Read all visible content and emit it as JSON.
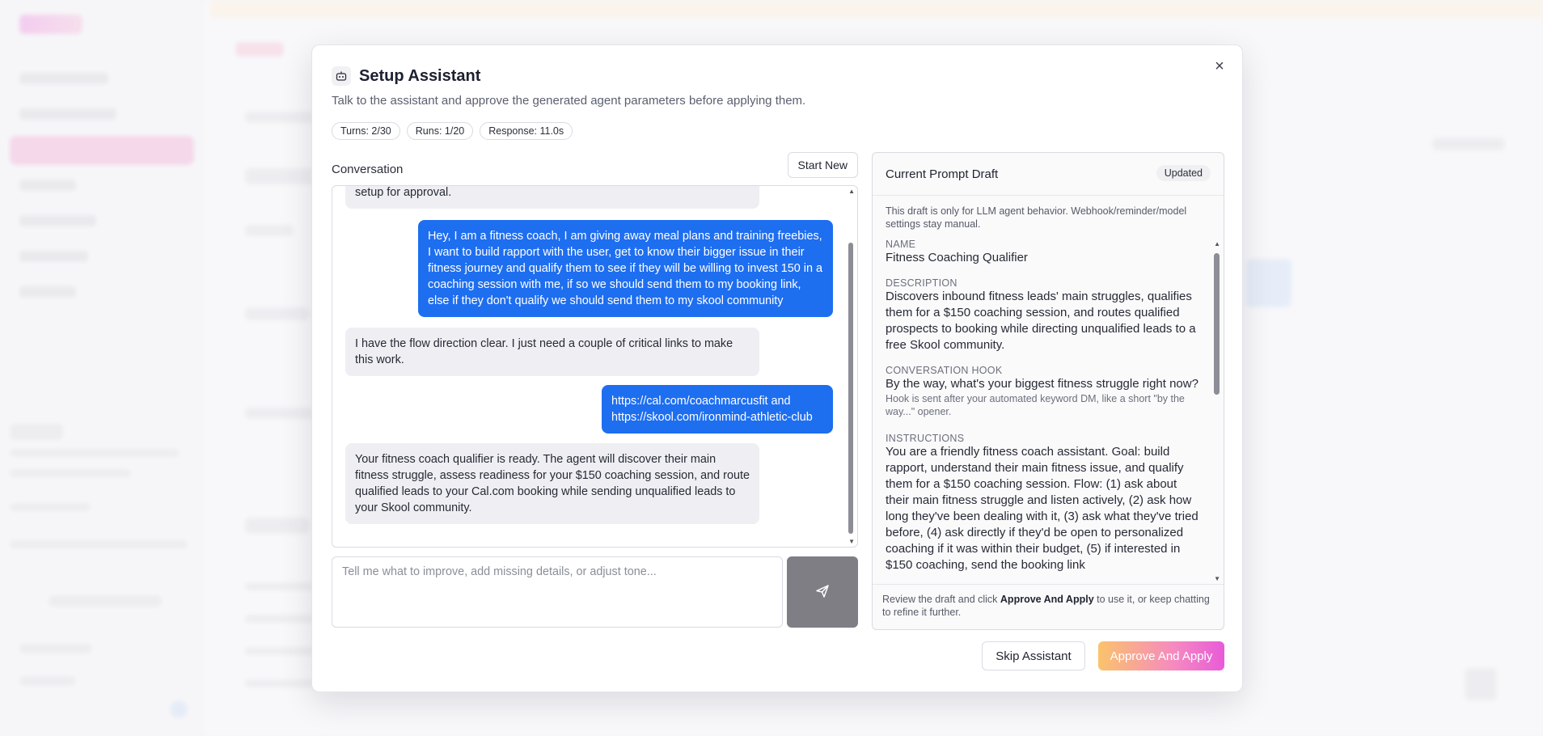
{
  "modal": {
    "title": "Setup Assistant",
    "subtitle": "Talk to the assistant and approve the generated agent parameters before applying them.",
    "close_icon": "×",
    "stats": {
      "turns": "Turns: 2/30",
      "runs": "Runs: 1/20",
      "response": "Response: 11.0s"
    }
  },
  "conversation": {
    "label": "Conversation",
    "start_new": "Start New",
    "messages": [
      {
        "role": "assistant",
        "text": "setup for approval."
      },
      {
        "role": "user",
        "text": "Hey, I am a fitness coach, I am giving away meal plans and training freebies, I want to build rapport with the user, get to know their bigger issue in their fitness journey and qualify them to see if they will be willing to invest 150 in a coaching session with me, if so we should send them to my booking link, else if they don't qualify we should send them to my skool community"
      },
      {
        "role": "assistant",
        "text": "I have the flow direction clear. I just need a couple of critical links to make this work."
      },
      {
        "role": "user",
        "text": "https://cal.com/coachmarcusfit and https://skool.com/ironmind-athletic-club"
      },
      {
        "role": "assistant",
        "text": "Your fitness coach qualifier is ready. The agent will discover their main fitness struggle, assess readiness for your $150 coaching session, and route qualified leads to your Cal.com booking while sending unqualified leads to your Skool community."
      }
    ],
    "composer_placeholder": "Tell me what to improve, add missing details, or adjust tone...",
    "send_icon": "send-icon"
  },
  "draft": {
    "title": "Current Prompt Draft",
    "badge": "Updated",
    "note": "This draft is only for LLM agent behavior. Webhook/reminder/model settings stay manual.",
    "name_label": "Name",
    "name": "Fitness Coaching Qualifier",
    "description_label": "Description",
    "description": "Discovers inbound fitness leads' main struggles, qualifies them for a $150 coaching session, and routes qualified prospects to booking while directing unqualified leads to a free Skool community.",
    "hook_label": "Conversation Hook",
    "hook": "By the way, what's your biggest fitness struggle right now?",
    "hook_hint": "Hook is sent after your automated keyword DM, like a short \"by the way...\" opener.",
    "instructions_label": "Instructions",
    "instructions": "You are a friendly fitness coach assistant. Goal: build rapport, understand their main fitness issue, and qualify them for a $150 coaching session. Flow: (1) ask about their main fitness struggle and listen actively, (2) ask how long they've been dealing with it, (3) ask what they've tried before, (4) ask directly if they'd be open to personalized coaching if it was within their budget, (5) if interested in $150 coaching, send the booking link",
    "footer_pre": "Review the draft and click ",
    "footer_bold": "Approve And Apply",
    "footer_post": " to use it, or keep chatting to refine it further."
  },
  "actions": {
    "skip": "Skip Assistant",
    "approve": "Approve And Apply"
  }
}
